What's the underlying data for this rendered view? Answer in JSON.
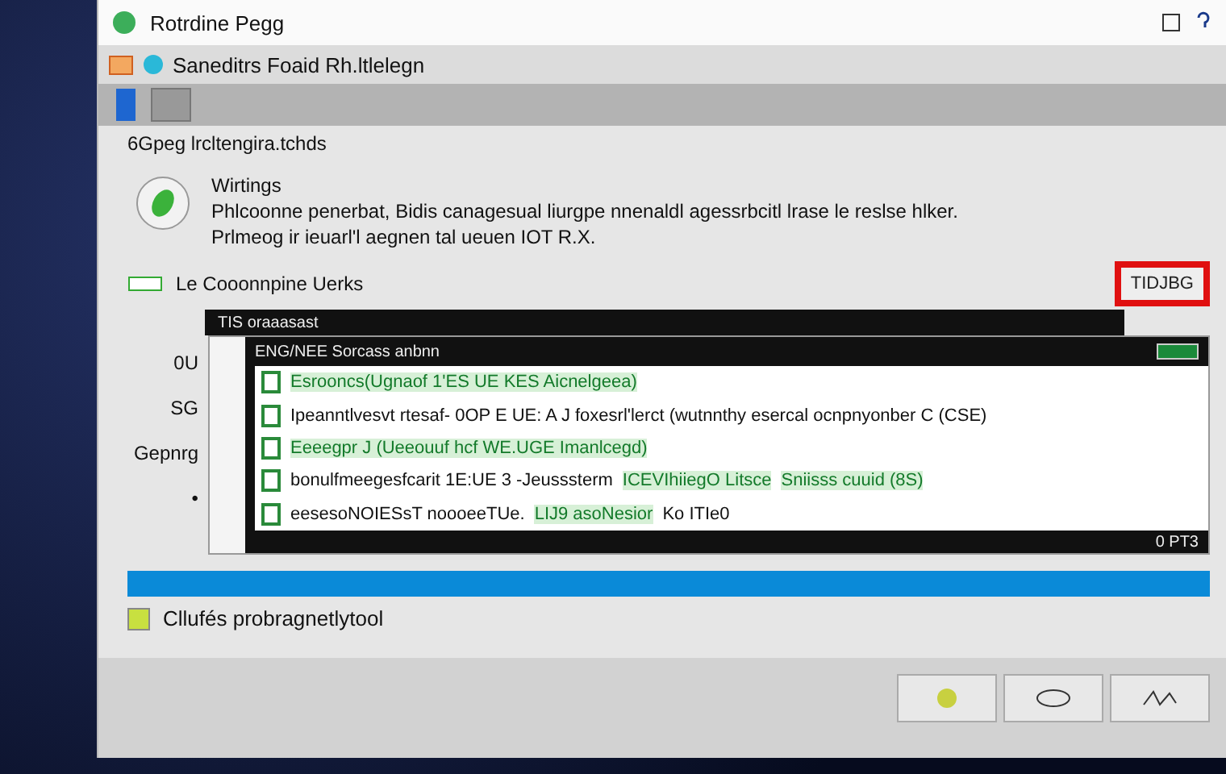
{
  "window": {
    "title": "Rotrdine Pegg"
  },
  "menu": {
    "label": "Saneditrs Foaid Rh.ltlelegn"
  },
  "path": "6Gpeg lrcltengira.tchds",
  "notice": {
    "heading": "Wirtings",
    "lines": [
      "Phlcoonne penerbat, Bidis canagesual liurgpe nnenaldl agessrbcitl lrase le reslse hlker.",
      "Prlmeog ir ieuarl'l aegnen tal ueuen IOT R.X."
    ]
  },
  "section": {
    "label": "Le Cooonnpine Uerks",
    "button": "TIDJBG",
    "bar": "TIS oraaasast"
  },
  "side_labels": [
    "0U",
    "SG",
    "Gepnrg",
    "•"
  ],
  "list": {
    "header": "ENG/NEE Sorcass anbnn",
    "footer": "0 PT3",
    "rows": [
      {
        "segments": [
          {
            "text": "Esrooncs(Ugnaof 1'ES UE KES Aicnelgeea)",
            "highlight": true
          }
        ]
      },
      {
        "segments": [
          {
            "text": "Ipeanntlvesvt rtesaf- 0OP E UE: A J foxesrl'lerct (wutnnthy esercal ocnpnyonber C (CSE)",
            "highlight": false
          }
        ]
      },
      {
        "segments": [
          {
            "text": "Eeeegpr J (Ueeouuf hcf WE.UGE Imanlcegd)",
            "highlight": true
          }
        ]
      },
      {
        "segments": [
          {
            "text": "bonulfmeegesfcarit 1E:UE 3 -Jeusssterm",
            "highlight": false
          },
          {
            "text": "ICEVIhiiegO Litsce",
            "highlight": true
          },
          {
            "text": "Sniisss cuuid (8S)",
            "highlight": true
          }
        ]
      },
      {
        "segments": [
          {
            "text": "eesesoNOIESsT noooeeTUe.",
            "highlight": false
          },
          {
            "text": "LIJ9 asoNesior",
            "highlight": true
          },
          {
            "text": "Ko ITIe0",
            "highlight": false
          }
        ]
      }
    ]
  },
  "progress": {
    "level": 1
  },
  "option": {
    "label": "Cllufés probragnetlytool",
    "checked": true
  }
}
